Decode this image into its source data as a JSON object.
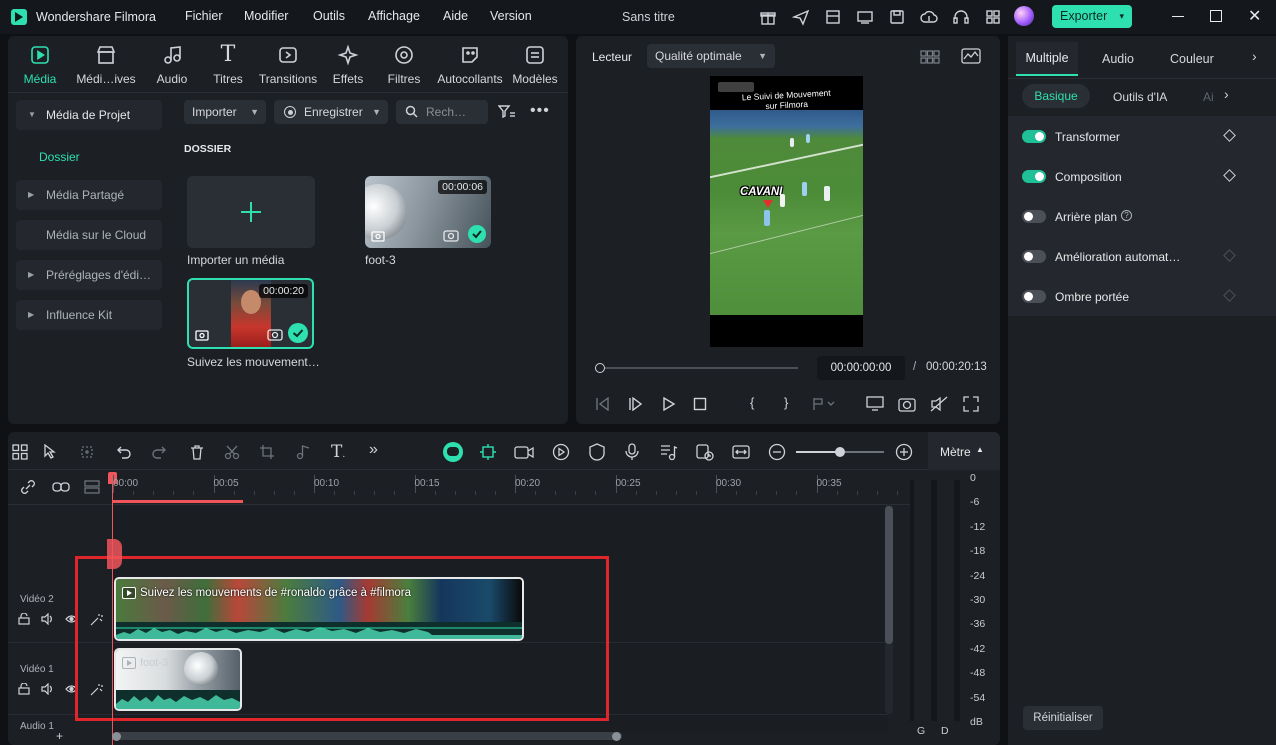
{
  "app": {
    "name": "Wondershare Filmora",
    "menu": [
      "Fichier",
      "Modifier",
      "Outils",
      "Affichage",
      "Aide",
      "Version"
    ],
    "project_title": "Sans titre",
    "export_label": "Exporter"
  },
  "media_tabs": [
    "Média",
    "Médi…ives",
    "Audio",
    "Titres",
    "Transitions",
    "Effets",
    "Filtres",
    "Autocollants",
    "Modèles"
  ],
  "sidebar": {
    "items": [
      "Média de Projet",
      "Dossier",
      "Média Partagé",
      "Média sur le Cloud",
      "Préréglages d'édi…",
      "Influence Kit"
    ]
  },
  "media_toolbar": {
    "import_label": "Importer",
    "record_label": "Enregistrer",
    "search_placeholder": "Rech…"
  },
  "media_grid": {
    "folder_heading": "DOSSIER",
    "import_tile_label": "Importer un média",
    "clips": [
      {
        "name": "foot-3",
        "duration": "00:00:06"
      },
      {
        "name": "Suivez les mouvement…",
        "duration": "00:00:20"
      }
    ]
  },
  "player": {
    "label": "Lecteur",
    "quality": "Qualité optimale",
    "overlay_title_line1": "Le Suivi de Mouvement",
    "overlay_title_line2": "sur Filmora",
    "player_tag": "CAVANI",
    "current_time": "00:00:00:00",
    "separator": "/",
    "total_time": "00:00:20:13"
  },
  "properties": {
    "tabs": [
      "Multiple",
      "Audio",
      "Couleur"
    ],
    "subtabs": [
      "Basique",
      "Outils d'IA",
      "Ai"
    ],
    "options": [
      {
        "label": "Transformer",
        "on": true
      },
      {
        "label": "Composition",
        "on": true
      },
      {
        "label": "Arrière plan",
        "on": false
      },
      {
        "label": "Amélioration automat…",
        "on": false
      },
      {
        "label": "Ombre portée",
        "on": false
      }
    ],
    "reset_label": "Réinitialiser"
  },
  "timeline": {
    "meter_label": "Mètre",
    "ruler": [
      "00:00",
      "00:05",
      "00:10",
      "00:15",
      "00:20",
      "00:25",
      "00:30",
      "00:35"
    ],
    "db_scale": [
      "0",
      "-6",
      "-12",
      "-18",
      "-24",
      "-30",
      "-36",
      "-42",
      "-48",
      "-54",
      "dB"
    ],
    "meter_channels": [
      "G",
      "D"
    ],
    "tracks": [
      {
        "name": "Vidéo 2",
        "clip_title": "Suivez les mouvements de #ronaldo grâce à #filmora"
      },
      {
        "name": "Vidéo 1",
        "clip_title": "foot-3"
      },
      {
        "name": "Audio 1"
      }
    ]
  },
  "colors": {
    "accent": "#2ee0b0",
    "highlight_box": "#e0262b",
    "playhead": "#f0555b",
    "panel_bg": "#1c1f24"
  }
}
